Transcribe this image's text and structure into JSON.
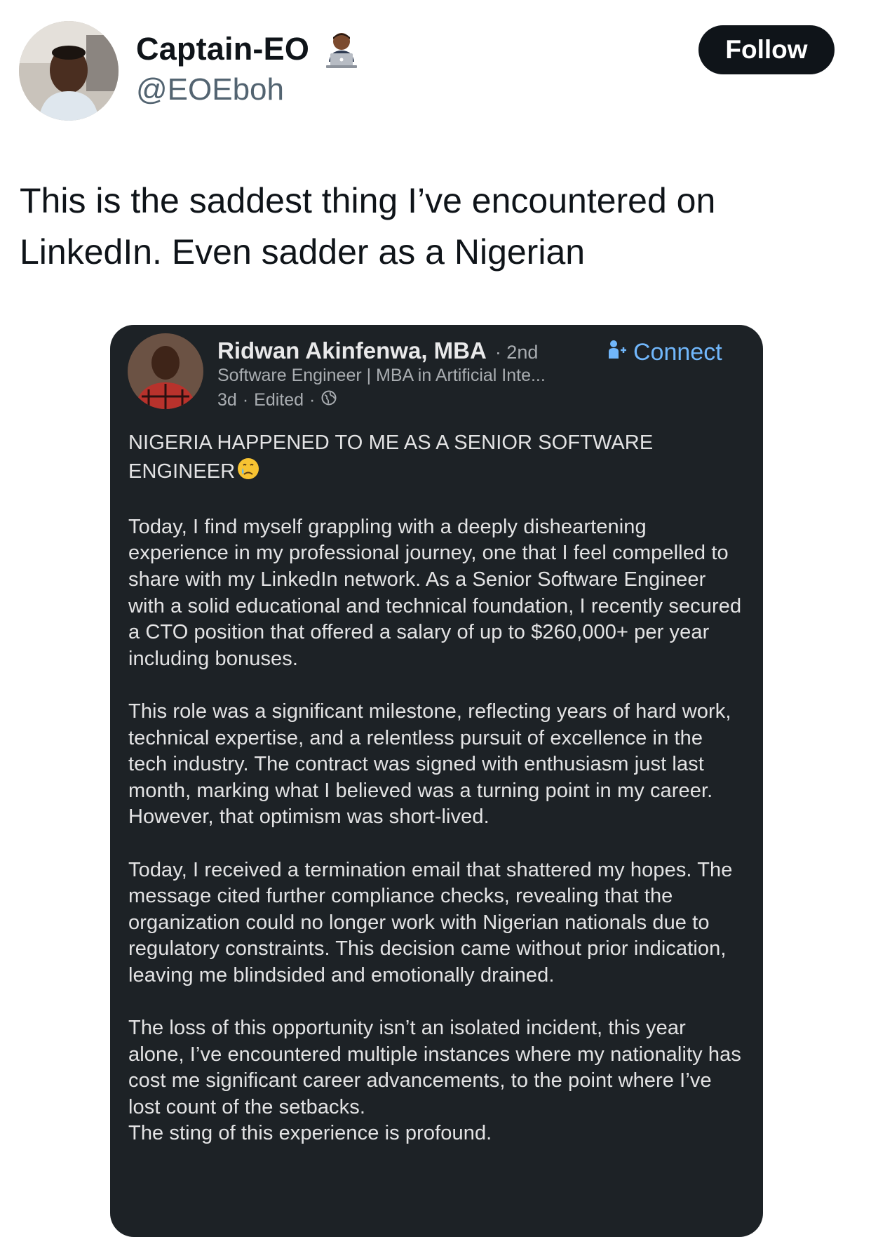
{
  "tweet": {
    "author": {
      "display_name": "Captain-EO",
      "handle": "@EOEboh",
      "name_emoji": "technologist-emoji"
    },
    "follow_button_label": "Follow",
    "text": "This is the saddest thing I’ve encountered on LinkedIn. Even sadder as a Nigerian"
  },
  "linkedin_post": {
    "author": {
      "name": "Ridwan Akinfenwa, MBA",
      "degree": "· 2nd",
      "headline": "Software Engineer | MBA in Artificial Inte...",
      "posted": "3d",
      "edited": "Edited",
      "visibility_icon": "globe-icon"
    },
    "connect_label": "Connect",
    "title_line1": "NIGERIA HAPPENED TO ME AS A SENIOR SOFTWARE",
    "title_line2": "ENGINEER",
    "paragraphs": [
      "Today, I find myself grappling with a deeply disheartening experience in my professional journey, one that I feel compelled to share with my LinkedIn network. As a Senior Software Engineer with a solid educational and technical foundation, I recently secured a CTO position that offered a salary of up to $260,000+ per year including bonuses.",
      "This role was a significant milestone, reflecting years of hard work, technical expertise, and a relentless pursuit of excellence in the tech industry. The contract was signed with enthusiasm just last month, marking what I believed was a turning point in my career.",
      "However, that optimism was short-lived.",
      "Today, I received a termination email that shattered my hopes. The message cited further compliance checks, revealing that the organization could no longer work with Nigerian nationals due to regulatory constraints. This decision came without prior indication, leaving me blindsided and emotionally drained.",
      "The loss of this opportunity isn’t an isolated incident, this year alone, I’ve encountered multiple instances where my nationality has cost me significant career advancements, to the point where I’ve lost count of the setbacks.",
      "The sting of this experience is profound."
    ]
  },
  "colors": {
    "follow_bg": "#0f1419",
    "card_bg": "#1d2226",
    "connect_blue": "#71b7fb",
    "handle_gray": "#536471"
  }
}
